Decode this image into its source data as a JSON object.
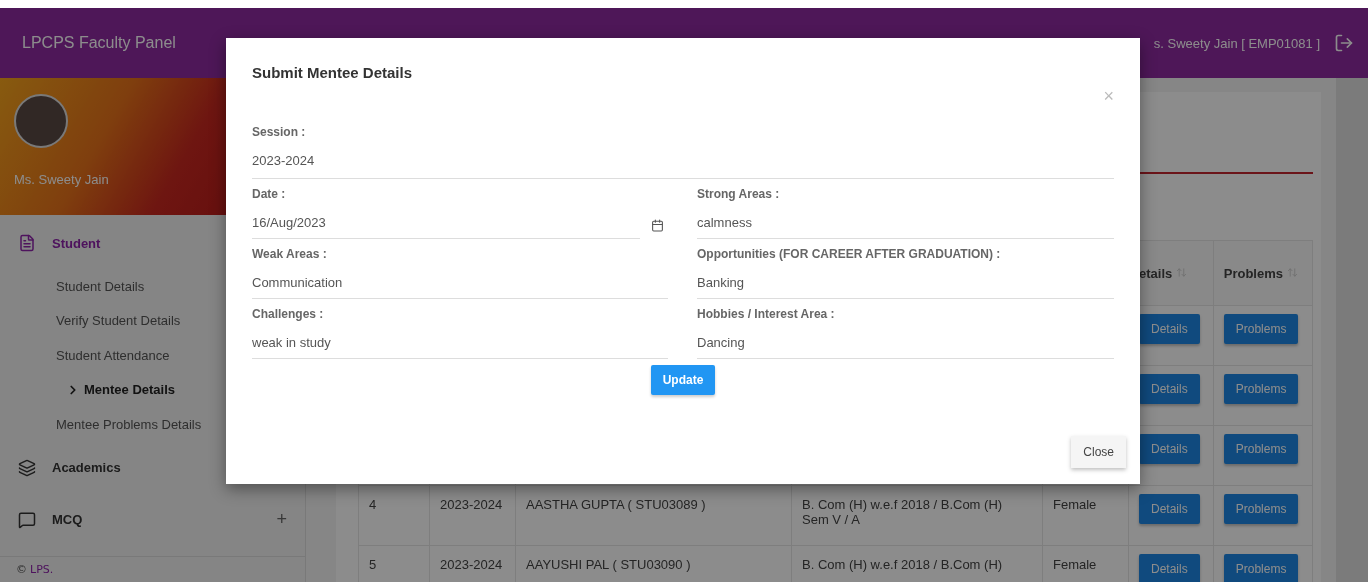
{
  "header": {
    "title": "LPCPS Faculty Panel",
    "user": "s. Sweety Jain [ EMP01081 ]"
  },
  "sidebar": {
    "profile_name": "Ms. Sweety Jain",
    "items": [
      {
        "label": "Student",
        "expanded": true,
        "children": [
          {
            "label": "Student Details",
            "selected": false
          },
          {
            "label": "Verify Student Details",
            "selected": false
          },
          {
            "label": "Student Attendance",
            "selected": false
          },
          {
            "label": "Mentee Details",
            "selected": true
          },
          {
            "label": "Mentee Problems Details",
            "selected": false
          }
        ]
      },
      {
        "label": "Academics",
        "expanded": false
      },
      {
        "label": "MCQ",
        "expanded": false,
        "expand_symbol": "+"
      }
    ],
    "footer": {
      "symbol": "©",
      "brand": "LPS."
    }
  },
  "table": {
    "columns": [
      {
        "label": "etails"
      },
      {
        "label": "Problems"
      }
    ],
    "rows": [
      {
        "details": "Details",
        "problems": "Problems"
      },
      {
        "details": "Details",
        "problems": "Problems"
      },
      {
        "details": "Details",
        "problems": "Problems"
      },
      {
        "number": "4",
        "session": "2023-2024",
        "name": "AASTHA GUPTA ( STU03089 )",
        "course": "B. Com (H) w.e.f 2018 / B.Com (H) Sem V / A",
        "gender": "Female",
        "details": "Details",
        "problems": "Problems"
      },
      {
        "number": "5",
        "session": "2023-2024",
        "name": "AAYUSHI PAL ( STU03090 )",
        "course": "B. Com (H) w.e.f 2018 / B.Com (H)",
        "gender": "Female",
        "details": "Details",
        "problems": "Problems"
      }
    ]
  },
  "modal": {
    "title": "Submit Mentee Details",
    "close_symbol": "×",
    "session": {
      "label": "Session :",
      "value": "2023-2024"
    },
    "fields": [
      {
        "label": "Date :",
        "value": "16/Aug/2023",
        "kind": "date"
      },
      {
        "label": "Strong Areas :",
        "value": "calmness",
        "kind": "text"
      },
      {
        "label": "Weak Areas :",
        "value": "Communication",
        "kind": "text"
      },
      {
        "label": "Opportunities (FOR CAREER AFTER GRADUATION) :",
        "value": "Banking",
        "kind": "text"
      },
      {
        "label": "Challenges :",
        "value": "weak in study",
        "kind": "text"
      },
      {
        "label": "Hobbies / Interest Area :",
        "value": "Dancing",
        "kind": "text"
      }
    ],
    "update_button": "Update",
    "close_button": "Close"
  }
}
